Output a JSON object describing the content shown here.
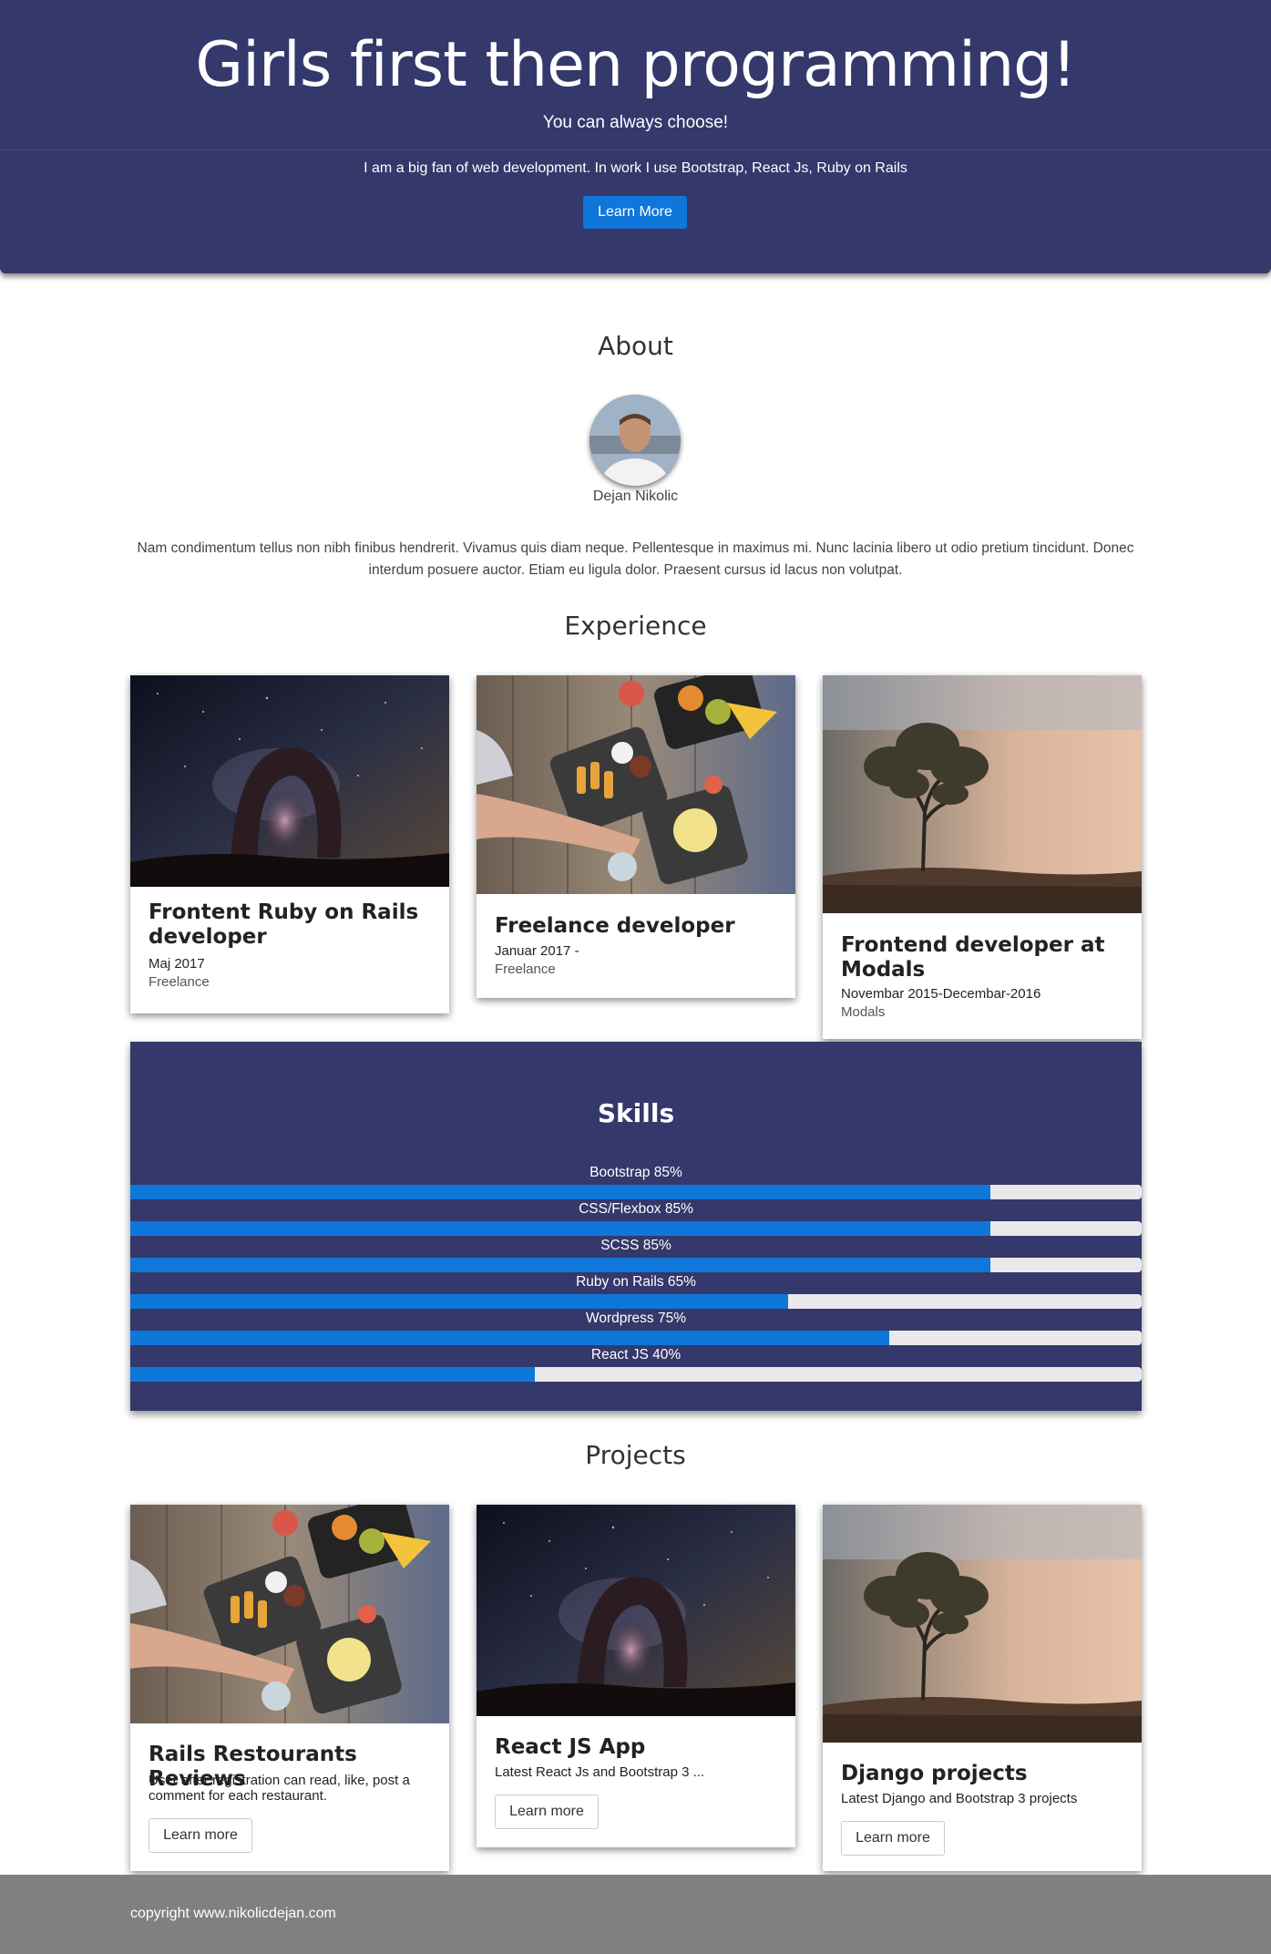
{
  "hero": {
    "title": "Girls first then programming!",
    "subtitle": "You can always choose!",
    "description": "I am a big fan of web development. In work I use Bootstrap, React Js, Ruby on Rails",
    "button_label": "Learn More"
  },
  "about": {
    "title": "About",
    "name": "Dejan Nikolic",
    "text": "Nam condimentum tellus non nibh finibus hendrerit. Vivamus quis diam neque. Pellentesque in maximus mi. Nunc lacinia libero ut odio pretium tincidunt. Donec interdum posuere auctor. Etiam eu ligula dolor. Praesent cursus id lacus non volutpat."
  },
  "experience": {
    "title": "Experience",
    "cards": [
      {
        "title": "Frontent Ruby on Rails developer",
        "date": "Maj 2017",
        "company": "Freelance",
        "image": "night-sky-arch"
      },
      {
        "title": "Freelance developer",
        "date": "Januar 2017 -",
        "company": "Freelance",
        "image": "food-table"
      },
      {
        "title": "Frontend developer at Modals",
        "date": "Novembar 2015-Decembar-2016",
        "company": "Modals",
        "image": "misty-tree"
      }
    ]
  },
  "skills": {
    "title": "Skills",
    "items": [
      {
        "label": "Bootstrap 85%",
        "percent": 85
      },
      {
        "label": "CSS/Flexbox 85%",
        "percent": 85
      },
      {
        "label": "SCSS 85%",
        "percent": 85
      },
      {
        "label": "Ruby on Rails 65%",
        "percent": 65
      },
      {
        "label": "Wordpress 75%",
        "percent": 75
      },
      {
        "label": "React JS 40%",
        "percent": 40
      }
    ]
  },
  "projects": {
    "title": "Projects",
    "cards": [
      {
        "title": "Rails Restourants Reviews",
        "description": "User after registration can read, like, post a comment for each restaurant.",
        "button_label": "Learn more",
        "image": "food-table"
      },
      {
        "title": "React JS App",
        "description": "Latest React Js and Bootstrap 3 ...",
        "button_label": "Learn more",
        "image": "night-sky-arch"
      },
      {
        "title": "Django projects",
        "description": "Latest Django and Bootstrap 3 projects",
        "button_label": "Learn more",
        "image": "misty-tree"
      }
    ]
  },
  "footer": {
    "text": "copyright www.nikolicdejan.com"
  },
  "colors": {
    "primary": "#34386b",
    "accent": "#0f77d9",
    "footer": "#808080"
  }
}
